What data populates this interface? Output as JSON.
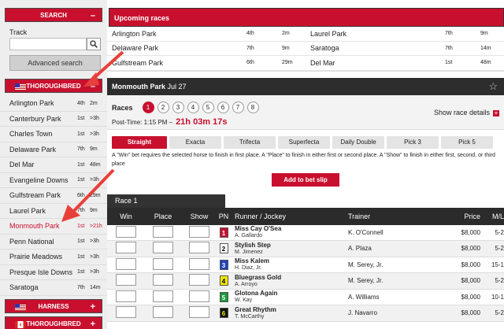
{
  "sidebar": {
    "search_title": "SEARCH",
    "search_toggle": "–",
    "track_label": "Track",
    "track_input_value": "",
    "advanced_label": "Advanced search",
    "thoroughbred_label": "THOROUGHBRED",
    "thoroughbred_toggle": "–",
    "tracks": [
      {
        "name": "Arlington Park",
        "pos": "4th",
        "time": "2m"
      },
      {
        "name": "Canterbury Park",
        "pos": "1st",
        "time": ">3h"
      },
      {
        "name": "Charles Town",
        "pos": "1st",
        "time": ">3h"
      },
      {
        "name": "Delaware Park",
        "pos": "7th",
        "time": "9m"
      },
      {
        "name": "Del Mar",
        "pos": "1st",
        "time": "48m"
      },
      {
        "name": "Evangeline Downs",
        "pos": "1st",
        "time": ">3h"
      },
      {
        "name": "Gulfstream Park",
        "pos": "6th",
        "time": "29m"
      },
      {
        "name": "Laurel Park",
        "pos": "7th",
        "time": "9m"
      },
      {
        "name": "Monmouth Park",
        "pos": "1st",
        "time": ">21h"
      },
      {
        "name": "Penn National",
        "pos": "1st",
        "time": ">3h"
      },
      {
        "name": "Prairie Meadows",
        "pos": "1st",
        "time": ">3h"
      },
      {
        "name": "Presque Isle Downs",
        "pos": "1st",
        "time": ">3h"
      },
      {
        "name": "Saratoga",
        "pos": "7th",
        "time": "14m"
      }
    ],
    "harness_label": "HARNESS",
    "harness_toggle": "+",
    "thoroughbred2_label": "THOROUGHBRED",
    "thoroughbred2_toggle": "+"
  },
  "upcoming": {
    "title": "Upcoming races",
    "left": [
      {
        "name": "Arlington Park",
        "pos": "4th",
        "time": "2m"
      },
      {
        "name": "Delaware Park",
        "pos": "7th",
        "time": "9m"
      },
      {
        "name": "Gulfstream Park",
        "pos": "6th",
        "time": "29m"
      }
    ],
    "right": [
      {
        "name": "Laurel Park",
        "pos": "7th",
        "time": "9m"
      },
      {
        "name": "Saratoga",
        "pos": "7th",
        "time": "14m"
      },
      {
        "name": "Del Mar",
        "pos": "1st",
        "time": "48m"
      }
    ]
  },
  "race_card": {
    "track": "Monmouth Park",
    "date": "Jul 27",
    "races_label": "Races",
    "races": [
      "1",
      "2",
      "3",
      "4",
      "5",
      "6",
      "7",
      "8"
    ],
    "active_race": "1",
    "post_time_label": "Post-Time: 1:15 PM  –",
    "post_time_countdown": "21h 03m 17s",
    "show_details": "Show race details",
    "bet_tabs": [
      "Straight",
      "Exacta",
      "Trifecta",
      "Superfecta",
      "Daily Double",
      "Pick 3",
      "Pick 5"
    ],
    "description": "A \"Win\" bet requires the selected horse to finish in first place. A \"Place\" to finish in either first or second place. A \"Show\" to finish in either first, second, or third place",
    "add_bet": "Add to bet slip",
    "race_header": "Race 1",
    "columns": {
      "win": "Win",
      "place": "Place",
      "show": "Show",
      "pn": "PN",
      "runner": "Runner / Jockey",
      "trainer": "Trainer",
      "price": "Price",
      "ml": "M/L"
    },
    "runners": [
      {
        "pn": "1",
        "horse": "Miss Cay O'Sea",
        "jockey": "A. Gallardo",
        "trainer": "K. O'Connell",
        "price": "$8,000",
        "ml": "5-2",
        "color": "#c8102e",
        "fg": "#ffffff"
      },
      {
        "pn": "2",
        "horse": "Stylish Step",
        "jockey": "M. Jimenez",
        "trainer": "A. Plaza",
        "price": "$8,000",
        "ml": "5-2",
        "color": "#ffffff",
        "fg": "#000000"
      },
      {
        "pn": "3",
        "horse": "Miss Kalem",
        "jockey": "H. Diaz, Jr.",
        "trainer": "M. Serey, Jr.",
        "price": "$8,000",
        "ml": "15-1",
        "color": "#1f3fbf",
        "fg": "#ffffff"
      },
      {
        "pn": "4",
        "horse": "Bluegrass Gold",
        "jockey": "A. Arroyo",
        "trainer": "M. Serey, Jr.",
        "price": "$8,000",
        "ml": "5-2",
        "color": "#f2e600",
        "fg": "#000000"
      },
      {
        "pn": "5",
        "horse": "Glotona Again",
        "jockey": "W. Kay",
        "trainer": "A. Williams",
        "price": "$8,000",
        "ml": "10-1",
        "color": "#1a9a3a",
        "fg": "#ffffff"
      },
      {
        "pn": "6",
        "horse": "Great Rhythm",
        "jockey": "T. McCarthy",
        "trainer": "J. Navarro",
        "price": "$8,000",
        "ml": "5-2",
        "color": "#111111",
        "fg": "#f2e600"
      }
    ]
  }
}
